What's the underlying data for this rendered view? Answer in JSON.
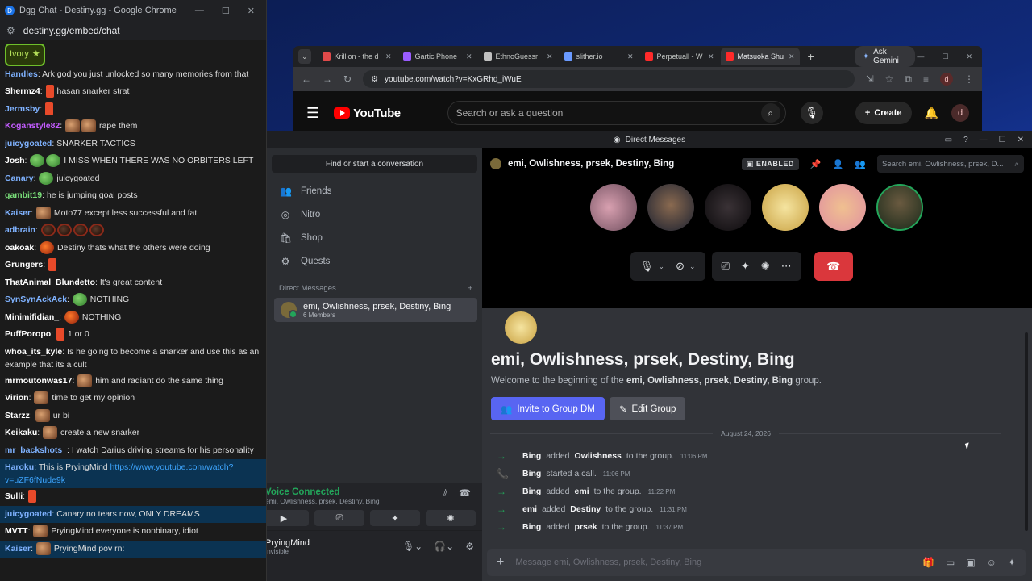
{
  "chat_window": {
    "title": "Dgg Chat - Destiny.gg - Google Chrome",
    "url": "destiny.gg/embed/chat",
    "badge": "Ivory",
    "messages": [
      {
        "user": "Handles",
        "color": "#7fb2ff",
        "text": "Ark god you just unlocked so many memories from that"
      },
      {
        "user": "Shermz4",
        "color": "#ffffff",
        "text": "hasan snarker strat"
      },
      {
        "user": "Jermsby",
        "color": "#7fb2ff",
        "text": ""
      },
      {
        "user": "Koganstyle82",
        "color": "#c35cff",
        "text": "rape them"
      },
      {
        "user": "juicygoated",
        "color": "#7fb2ff",
        "text": "SNARKER TACTICS"
      },
      {
        "user": "Josh",
        "color": "#ffffff",
        "text": "I MISS WHEN THERE WAS NO ORBITERS LEFT"
      },
      {
        "user": "Canary",
        "color": "#7fb2ff",
        "text": "juicygoated"
      },
      {
        "user": "gambit19",
        "color": "#7ae07a",
        "text": "he is jumping goal posts"
      },
      {
        "user": "Kaiser",
        "color": "#7fb2ff",
        "text": "Moto77 except less successful and fat"
      },
      {
        "user": "adbrain",
        "color": "#7fb2ff",
        "text": ""
      },
      {
        "user": "oakoak",
        "color": "#ffffff",
        "text": "Destiny thats what the others were doing"
      },
      {
        "user": "Grungers",
        "color": "#ffffff",
        "text": ""
      },
      {
        "user": "ThatAnimal_Blundetto",
        "color": "#ffffff",
        "text": "It's great content"
      },
      {
        "user": "SynSynAckAck",
        "color": "#7fb2ff",
        "text": "NOTHING"
      },
      {
        "user": "Minimifidian_",
        "color": "#ffffff",
        "text": "NOTHING"
      },
      {
        "user": "PuffPoropo",
        "color": "#ffffff",
        "text": "1 or 0"
      },
      {
        "user": "whoa_its_kyle",
        "color": "#ffffff",
        "text": "Is he going to become a snarker and use this as an example that its a cult"
      },
      {
        "user": "mrmoutonwas17",
        "color": "#ffffff",
        "text": "him and radiant do the same thing"
      },
      {
        "user": "Virion",
        "color": "#ffffff",
        "text": "time to get my opinion"
      },
      {
        "user": "Starzz",
        "color": "#ffffff",
        "text": "ur bi"
      },
      {
        "user": "Keikaku",
        "color": "#ffffff",
        "text": "create a new snarker"
      },
      {
        "user": "mr_backshots_",
        "color": "#7fb2ff",
        "text": "I watch Darius driving streams for his personality"
      },
      {
        "user": "Haroku",
        "color": "#7fb2ff",
        "text": "This is PryingMind",
        "link": "https://www.youtube.com/watch?v=uZF6fNude9k"
      },
      {
        "user": "Sulli",
        "color": "#ffffff",
        "text": ""
      },
      {
        "user": "juicygoated",
        "color": "#7fb2ff",
        "text": "Canary no tears now, ONLY DREAMS"
      },
      {
        "user": "MVTT",
        "color": "#ffffff",
        "text": "PryingMind everyone is nonbinary, idiot"
      },
      {
        "user": "Kaiser",
        "color": "#7fb2ff",
        "text": "PryingMind pov rn:"
      }
    ]
  },
  "browser": {
    "tabs": [
      {
        "label": "Krillion - the d",
        "color": "#e04a4a"
      },
      {
        "label": "Gartic Phone",
        "color": "#9a5cff"
      },
      {
        "label": "EthnoGuessr",
        "color": "#c0c0c0"
      },
      {
        "label": "slither.io",
        "color": "#6a9aff"
      },
      {
        "label": "Perpetuall - W",
        "color": "#ff2a2a"
      },
      {
        "label": "Matsuoka Shu",
        "color": "#ff2a2a"
      }
    ],
    "gemini": "Ask Gemini",
    "url": "youtube.com/watch?v=KxGRhd_iWuE",
    "avatar": "d",
    "youtube": {
      "logo": "YouTube",
      "search_placeholder": "Search or ask a question",
      "create": "Create",
      "avatar": "d"
    }
  },
  "discord": {
    "title": "Direct Messages",
    "find": "Find or start a conversation",
    "nav": [
      {
        "label": "Friends",
        "icon": "👥"
      },
      {
        "label": "Nitro",
        "icon": "◎"
      },
      {
        "label": "Shop",
        "icon": "🛍"
      },
      {
        "label": "Quests",
        "icon": "⚙"
      }
    ],
    "dm_section": "Direct Messages",
    "dm_name": "emi, Owlishness, prsek, Destiny, Bing",
    "dm_members": "6 Members",
    "voice_status": "Voice Connected",
    "voice_channel": "emi, Owlishness, prsek, Destiny, Bing",
    "username": "PryingMind",
    "user_status": "Invisible",
    "header_title": "emi, Owlishness, prsek, Destiny, Bing",
    "enabled": "ENABLED",
    "search_placeholder": "Search emi, Owlishness, prsek, D...",
    "welcome_title": "emi, Owlishness, prsek, Destiny, Bing",
    "welcome_prefix": "Welcome to the beginning of the ",
    "welcome_group": "emi, Owlishness, prsek, Destiny, Bing",
    "welcome_suffix": " group.",
    "invite_btn": "Invite to Group DM",
    "edit_btn": "Edit Group",
    "date": "August 24, 2026",
    "events": [
      {
        "icon": "→",
        "actor": "Bing",
        "verb": "added",
        "target": "Owlishness",
        "tail": "to the group.",
        "time": "11:06 PM"
      },
      {
        "icon": "📞",
        "actor": "Bing",
        "verb": "started a call.",
        "target": "",
        "tail": "",
        "time": "11:06 PM"
      },
      {
        "icon": "→",
        "actor": "Bing",
        "verb": "added",
        "target": "emi",
        "tail": "to the group.",
        "time": "11:22 PM"
      },
      {
        "icon": "→",
        "actor": "emi",
        "verb": "added",
        "target": "Destiny",
        "tail": "to the group.",
        "time": "11:31 PM"
      },
      {
        "icon": "→",
        "actor": "Bing",
        "verb": "added",
        "target": "prsek",
        "tail": "to the group.",
        "time": "11:37 PM"
      }
    ],
    "composer_placeholder": "Message emi, Owlishness, prsek, Destiny, Bing"
  }
}
